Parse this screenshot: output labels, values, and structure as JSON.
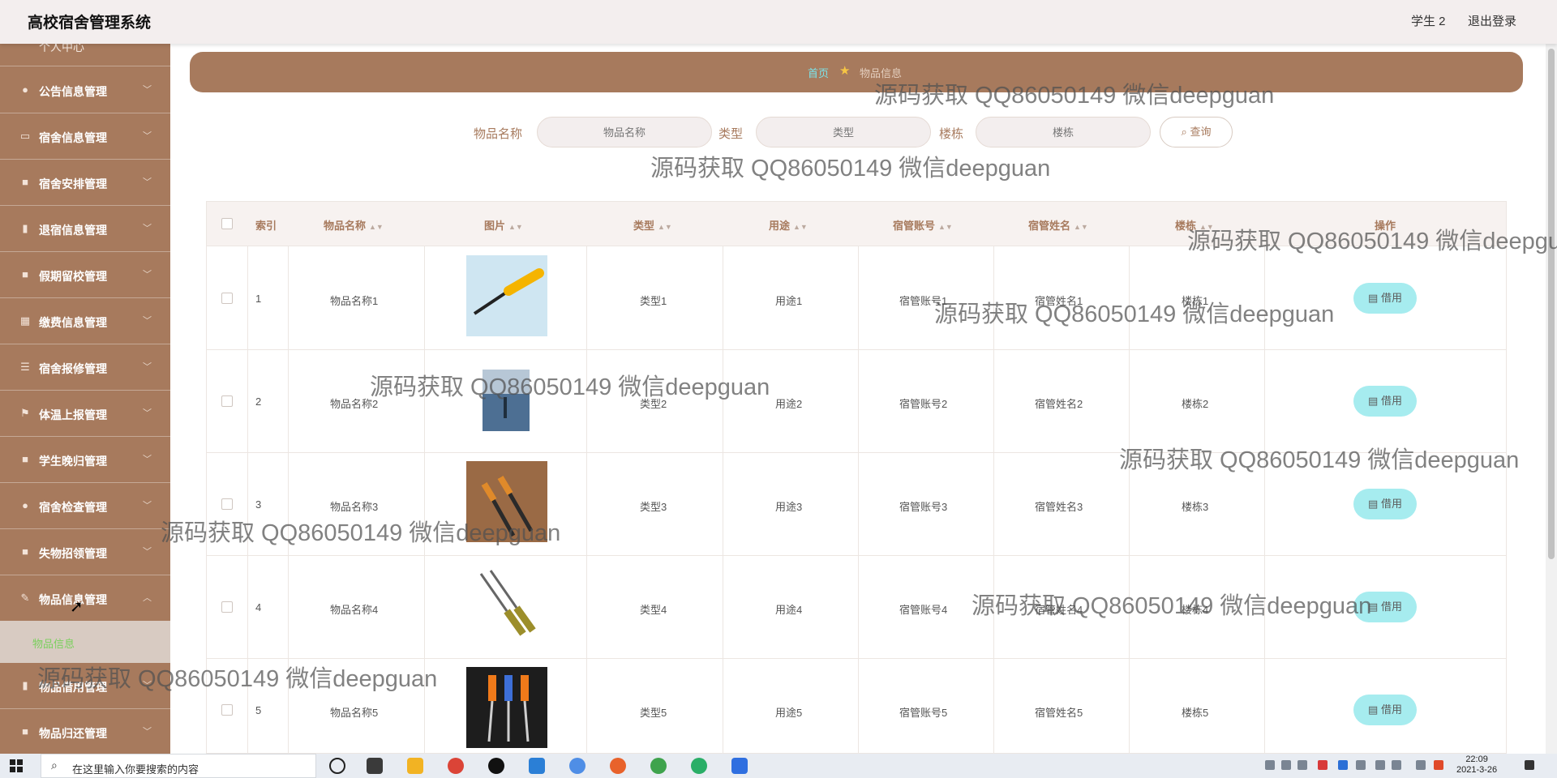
{
  "header": {
    "app_title": "高校宿舍管理系统",
    "user": "学生 2",
    "logout": "退出登录"
  },
  "sidebar": {
    "cut_item": "个人中心",
    "items": [
      {
        "label": "公告信息管理",
        "icon": "bell-icon"
      },
      {
        "label": "宿舍信息管理",
        "icon": "card-icon"
      },
      {
        "label": "宿舍安排管理",
        "icon": "briefcase-icon"
      },
      {
        "label": "退宿信息管理",
        "icon": "mic-icon"
      },
      {
        "label": "假期留校管理",
        "icon": "book-icon"
      },
      {
        "label": "缴费信息管理",
        "icon": "grid-icon"
      },
      {
        "label": "宿舍报修管理",
        "icon": "sliders-icon"
      },
      {
        "label": "体温上报管理",
        "icon": "flag-icon"
      },
      {
        "label": "学生晚归管理",
        "icon": "briefcase-icon"
      },
      {
        "label": "宿舍检查管理",
        "icon": "user-icon"
      },
      {
        "label": "失物招领管理",
        "icon": "folder-icon"
      },
      {
        "label": "物品信息管理",
        "icon": "edit-icon"
      },
      {
        "label": "物品借用管理",
        "icon": "mic-icon"
      },
      {
        "label": "物品归还管理",
        "icon": "book-icon"
      }
    ],
    "sub_item": "物品信息"
  },
  "breadcrumb": {
    "home": "首页",
    "current": "物品信息"
  },
  "search": {
    "name_label": "物品名称",
    "name_placeholder": "物品名称",
    "type_label": "类型",
    "type_placeholder": "类型",
    "building_label": "楼栋",
    "building_placeholder": "楼栋",
    "button": "查询"
  },
  "table": {
    "columns": [
      "索引",
      "物品名称",
      "图片",
      "类型",
      "用途",
      "宿管账号",
      "宿管姓名",
      "楼栋",
      "操作"
    ],
    "action_label": "借用",
    "rows": [
      {
        "index": "1",
        "name": "物品名称1",
        "type": "类型1",
        "usage": "用途1",
        "account": "宿管账号1",
        "manager": "宿管姓名1",
        "building": "楼栋1"
      },
      {
        "index": "2",
        "name": "物品名称2",
        "type": "类型2",
        "usage": "用途2",
        "account": "宿管账号2",
        "manager": "宿管姓名2",
        "building": "楼栋2"
      },
      {
        "index": "3",
        "name": "物品名称3",
        "type": "类型3",
        "usage": "用途3",
        "account": "宿管账号3",
        "manager": "宿管姓名3",
        "building": "楼栋3"
      },
      {
        "index": "4",
        "name": "物品名称4",
        "type": "类型4",
        "usage": "用途4",
        "account": "宿管账号4",
        "manager": "宿管姓名4",
        "building": "楼栋4"
      },
      {
        "index": "5",
        "name": "物品名称5",
        "type": "类型5",
        "usage": "用途5",
        "account": "宿管账号5",
        "manager": "宿管姓名5",
        "building": "楼栋5"
      }
    ]
  },
  "watermark": "源码获取 QQ86050149 微信deepguan",
  "taskbar": {
    "search_placeholder": "在这里输入你要搜索的内容",
    "time": "22:09",
    "date": "2021-3-26"
  },
  "colors": {
    "brand": "#a77a5d",
    "accent": "#7ce4ea",
    "button": "#a6ecef"
  }
}
